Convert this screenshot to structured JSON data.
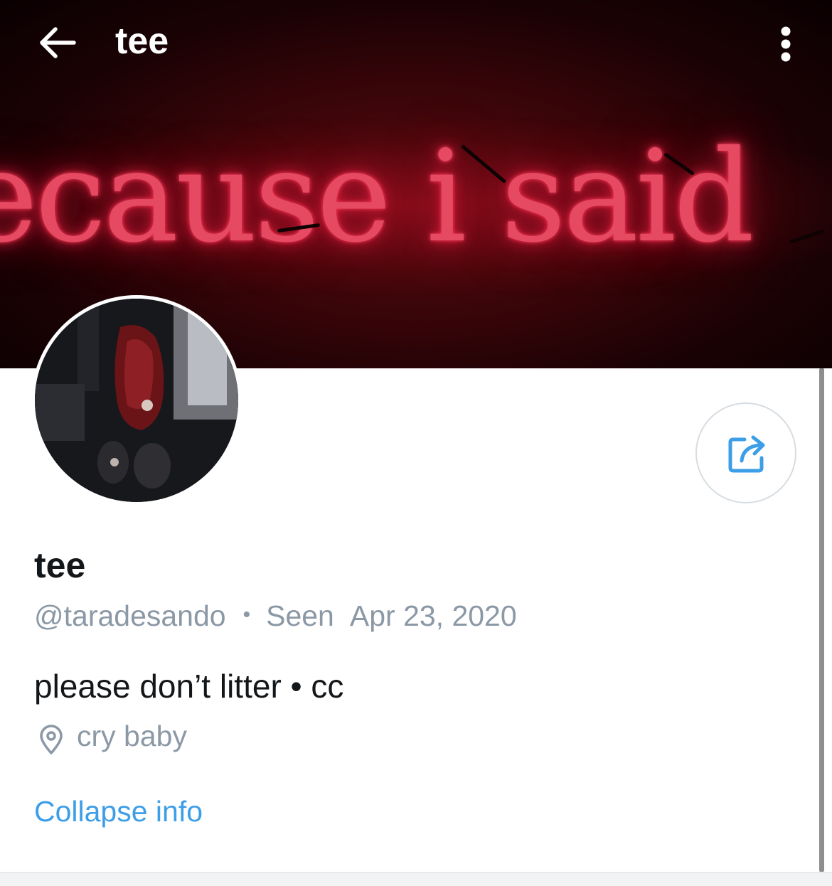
{
  "header": {
    "title": "tee",
    "banner_text": "ecause i said"
  },
  "profile": {
    "display_name": "tee",
    "handle": "@taradesando",
    "separator": "•",
    "seen_label": "Seen",
    "seen_date": "Apr 23, 2020",
    "bio": "please don’t litter • cc",
    "location": "cry baby",
    "collapse_label": "Collapse info"
  },
  "icons": {
    "back": "back-arrow-icon",
    "more": "more-vertical-icon",
    "share": "share-icon",
    "location": "location-pin-icon"
  },
  "colors": {
    "accent": "#3d9ee8",
    "muted": "#8b98a5",
    "text": "#14171a",
    "neon": "#e64a63"
  }
}
